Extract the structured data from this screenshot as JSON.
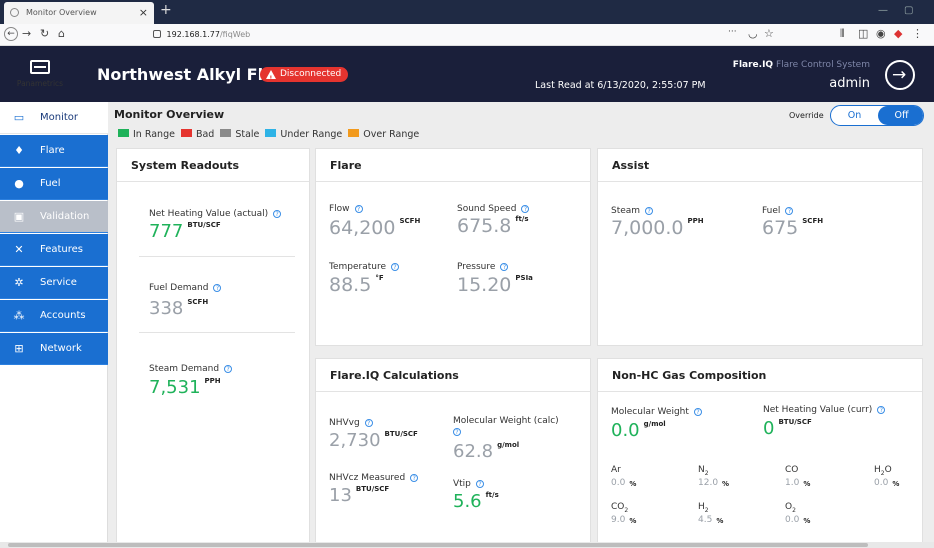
{
  "browser": {
    "tab_title": "Monitor Overview",
    "tab_close": "×",
    "new_tab": "+",
    "url_host": "192.168.1.77",
    "url_path": "/fiqWeb",
    "url_more": "···"
  },
  "header": {
    "logo_label": "Panametrics",
    "site_title": "Northwest Alkyl Flare",
    "status_badge": "Disconnected",
    "last_read": "Last Read at 6/13/2020, 2:55:07 PM",
    "brand_strong": "Flare.IQ",
    "brand_rest": " Flare Control System",
    "user": "admin"
  },
  "sidebar": {
    "items": [
      {
        "label": "Monitor",
        "icon": "monitor-icon",
        "glyph": "▭",
        "state": "active"
      },
      {
        "label": "Flare",
        "icon": "flame-icon",
        "glyph": "♦",
        "state": "normal"
      },
      {
        "label": "Fuel",
        "icon": "drop-icon",
        "glyph": "●",
        "state": "normal"
      },
      {
        "label": "Validation",
        "icon": "clipboard-icon",
        "glyph": "▣",
        "state": "disabled"
      },
      {
        "label": "Features",
        "icon": "tools-icon",
        "glyph": "✕",
        "state": "normal"
      },
      {
        "label": "Service",
        "icon": "gears-icon",
        "glyph": "✲",
        "state": "normal"
      },
      {
        "label": "Accounts",
        "icon": "users-icon",
        "glyph": "⁂",
        "state": "normal"
      },
      {
        "label": "Network",
        "icon": "network-icon",
        "glyph": "⊞",
        "state": "normal"
      }
    ]
  },
  "main": {
    "title": "Monitor Overview",
    "legend": [
      {
        "label": "In Range",
        "color": "#1fb25a"
      },
      {
        "label": "Bad",
        "color": "#e5342f"
      },
      {
        "label": "Stale",
        "color": "#8a8a8a"
      },
      {
        "label": "Under Range",
        "color": "#2eb3e6"
      },
      {
        "label": "Over Range",
        "color": "#f29a1d"
      }
    ],
    "override": {
      "label": "Override",
      "on": "On",
      "off": "Off",
      "selected": "Off"
    }
  },
  "system_readouts": {
    "title": "System Readouts",
    "nhv_label": "Net Heating Value (actual)",
    "nhv_value": "777",
    "nhv_unit": "BTU/SCF",
    "fuel_label": "Fuel Demand",
    "fuel_value": "338",
    "fuel_unit": "SCFH",
    "steam_label": "Steam Demand",
    "steam_value": "7,531",
    "steam_unit": "PPH"
  },
  "flare": {
    "title": "Flare",
    "flow_label": "Flow",
    "flow_value": "64,200",
    "flow_unit": "SCFH",
    "sound_label": "Sound Speed",
    "sound_value": "675.8",
    "sound_unit": "ft/s",
    "temp_label": "Temperature",
    "temp_value": "88.5",
    "temp_unit": "°F",
    "pressure_label": "Pressure",
    "pressure_value": "15.20",
    "pressure_unit": "PSIa"
  },
  "assist": {
    "title": "Assist",
    "steam_label": "Steam",
    "steam_value": "7,000.0",
    "steam_unit": "PPH",
    "fuel_label": "Fuel",
    "fuel_value": "675",
    "fuel_unit": "SCFH"
  },
  "calculations": {
    "title": "Flare.IQ Calculations",
    "nhvvg_label": "NHVvg",
    "nhvvg_value": "2,730",
    "nhvvg_unit": "BTU/SCF",
    "mw_label": "Molecular Weight (calc)",
    "mw_value": "62.8",
    "mw_unit": "g/mol",
    "nhvcz_label": "NHVcz Measured",
    "nhvcz_value": "13",
    "nhvcz_unit": "BTU/SCF",
    "vtip_label": "Vtip",
    "vtip_value": "5.6",
    "vtip_unit": "ft/s"
  },
  "nonhc": {
    "title": "Non-HC Gas Composition",
    "mw_label": "Molecular Weight",
    "mw_value": "0.0",
    "mw_unit": "g/mol",
    "nhv_label": "Net Heating Value (curr)",
    "nhv_value": "0",
    "nhv_unit": "BTU/SCF",
    "gases": [
      {
        "name": "Ar",
        "sub": "",
        "value": "0.0",
        "unit": "%"
      },
      {
        "name": "N",
        "sub": "2",
        "value": "12.0",
        "unit": "%"
      },
      {
        "name": "CO",
        "sub": "",
        "value": "1.0",
        "unit": "%"
      },
      {
        "name": "H",
        "sub": "2",
        "suffix": "O",
        "value": "0.0",
        "unit": "%"
      },
      {
        "name": "CO",
        "sub": "2",
        "value": "9.0",
        "unit": "%"
      },
      {
        "name": "H",
        "sub": "2",
        "value": "4.5",
        "unit": "%"
      },
      {
        "name": "O",
        "sub": "2",
        "value": "0.0",
        "unit": "%"
      }
    ]
  }
}
